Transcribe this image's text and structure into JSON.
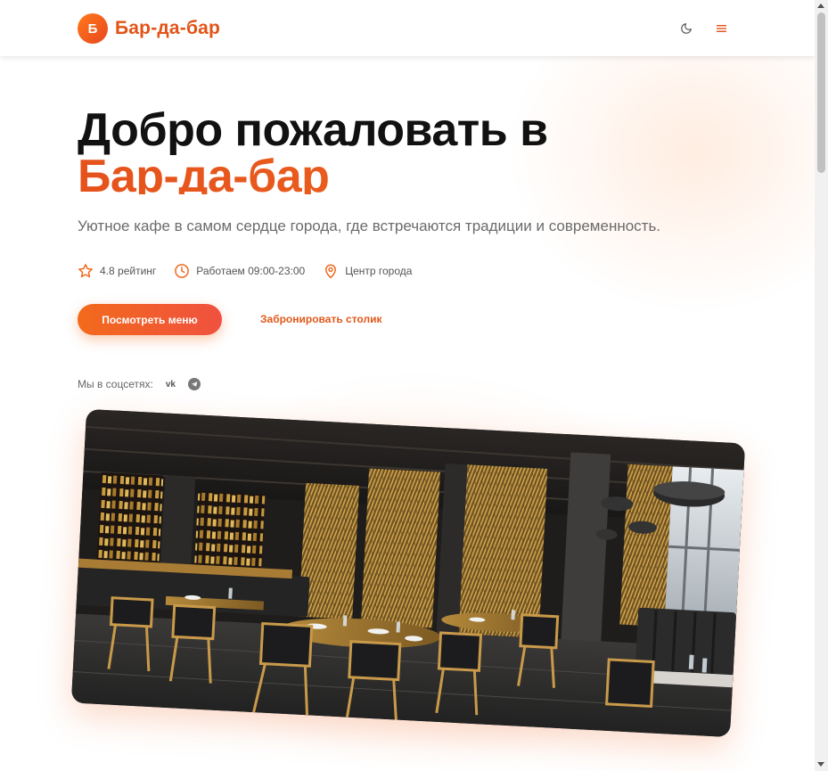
{
  "header": {
    "logo_letter": "Б",
    "brand": "Бар-да-бар",
    "theme_toggle_icon": "moon-icon",
    "menu_icon": "hamburger-icon"
  },
  "hero": {
    "title_line1": "Добро пожаловать в",
    "title_line2": "Бар-да-бар",
    "subtitle": "Уютное кафе в самом сердце города, где встречаются традиции и современность.",
    "features": [
      {
        "icon": "star-icon",
        "label": "4.8 рейтинг"
      },
      {
        "icon": "clock-icon",
        "label": "Работаем 09:00-23:00"
      },
      {
        "icon": "location-pin-icon",
        "label": "Центр города"
      }
    ],
    "primary_button": "Посмотреть меню",
    "secondary_button": "Забронировать столик",
    "social_label": "Мы в соцсетях:",
    "social_vk": "vk",
    "social_telegram_icon": "telegram-icon"
  },
  "colors": {
    "accent": "#e5521c",
    "accent_light": "#f26a1c",
    "text": "#111111",
    "muted": "#6b6b6b"
  }
}
